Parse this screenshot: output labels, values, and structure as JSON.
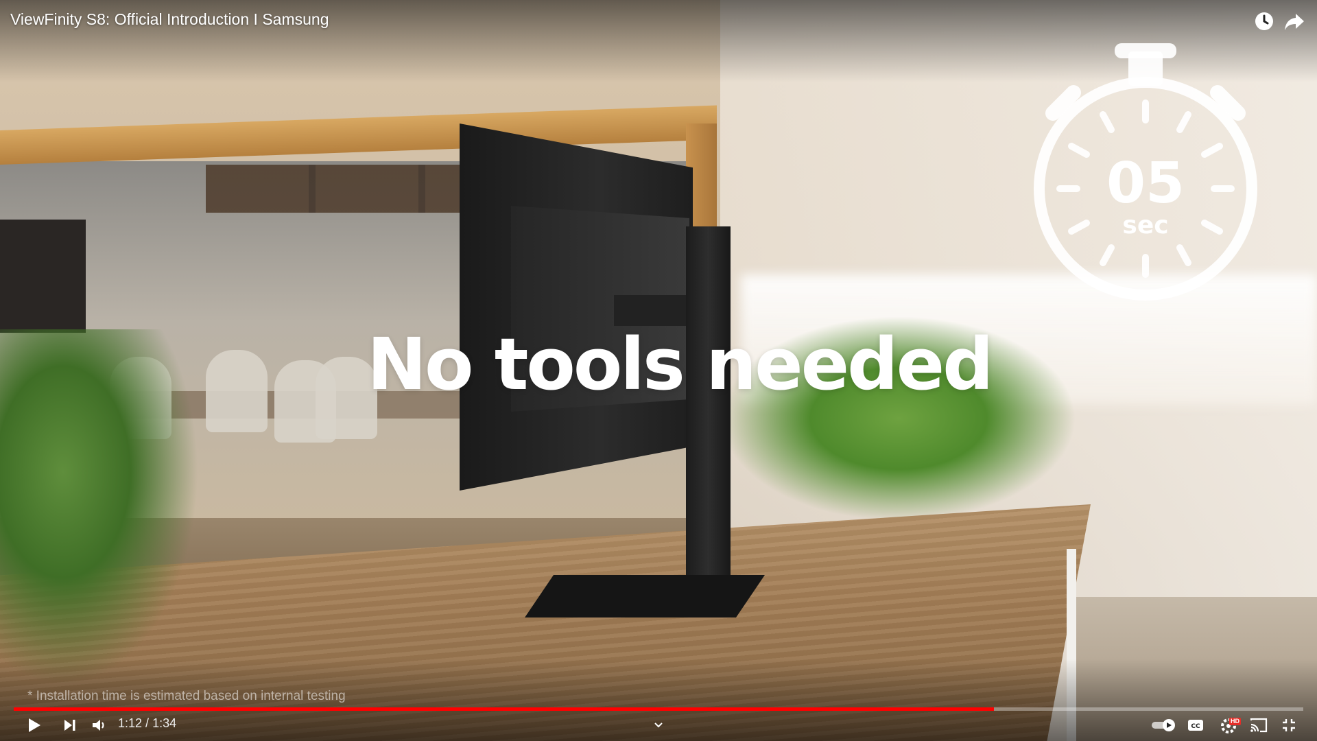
{
  "video": {
    "title": "ViewFinity S8: Official Introduction I Samsung",
    "headline": "No tools needed",
    "timer": {
      "value": "05",
      "unit": "sec"
    },
    "disclaimer": "* Installation time is estimated based on internal testing"
  },
  "player": {
    "current_time": "1:12",
    "separator": " / ",
    "duration": "1:34",
    "progress": 0.76,
    "quality_badge": "HD",
    "accent_color": "#ff0000"
  },
  "icons": {
    "top": [
      "watch-later-icon",
      "share-icon"
    ],
    "controls": [
      "play-icon",
      "next-icon",
      "volume-icon",
      "chevron-down-icon",
      "autoplay-toggle-icon",
      "captions-icon",
      "settings-icon",
      "cast-icon",
      "exit-fullscreen-icon"
    ]
  }
}
